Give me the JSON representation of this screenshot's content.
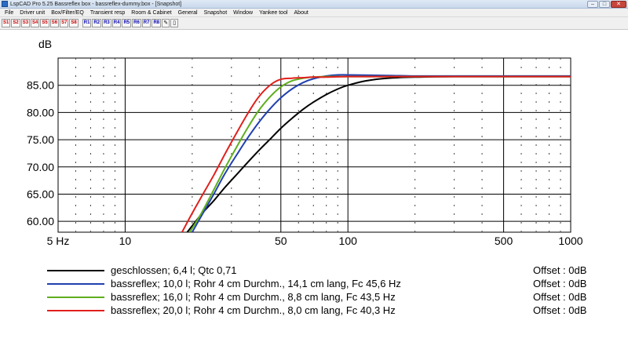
{
  "window": {
    "title": "LspCAD Pro 5.25 Bassreflex box - bassreflex-dummy.box - [Snapshot]",
    "minimize": "–",
    "maximize": "□",
    "close": "✕"
  },
  "menu": [
    "File",
    "Driver unit",
    "Box/Filter/EQ",
    "Transient resp",
    "Room & Cabinet",
    "General",
    "Snapshot",
    "Window",
    "Yankee tool",
    "About"
  ],
  "toolbar": {
    "snapshots": [
      "S1",
      "S2",
      "S3",
      "S4",
      "S5",
      "S6",
      "S7",
      "S8"
    ],
    "references": [
      "R1",
      "R2",
      "R3",
      "R4",
      "R5",
      "R6",
      "R7",
      "R8"
    ],
    "icons": [
      "pen-icon",
      "clipboard-icon"
    ],
    "snapshot_color": "#cc0000",
    "reference_color": "#0000b0"
  },
  "chart_data": {
    "type": "line",
    "ylabel": "dB",
    "xscale": "log",
    "xlim": [
      5,
      1000
    ],
    "ylim": [
      58,
      90
    ],
    "grid": true,
    "x_ticks": [
      5,
      10,
      50,
      100,
      500,
      1000
    ],
    "x_tick_labels": [
      "5 Hz",
      "10",
      "50",
      "100",
      "500",
      "1000"
    ],
    "y_ticks": [
      60,
      65,
      70,
      75,
      80,
      85
    ],
    "y_tick_labels": [
      "60.00",
      "65.00",
      "70.00",
      "75.00",
      "80.00",
      "85.00"
    ],
    "series": [
      {
        "name": "geschlossen; 6,4 l; Qtc 0,71",
        "offset": "Offset : 0dB",
        "color": "#000000",
        "x": [
          19,
          22,
          25,
          28,
          32,
          36,
          40,
          45,
          50,
          56,
          63,
          70,
          80,
          90,
          100,
          120,
          150,
          200,
          300,
          500,
          1000
        ],
        "y": [
          58,
          61.3,
          63.8,
          66.2,
          68.8,
          71.1,
          73.1,
          75.2,
          77.1,
          78.9,
          80.6,
          81.9,
          83.3,
          84.3,
          85.0,
          85.8,
          86.3,
          86.5,
          86.6,
          86.6,
          86.6
        ]
      },
      {
        "name": "bassreflex; 10,0 l; Rohr 4 cm Durchm., 14,1 cm lang,  Fc 45,6 Hz",
        "offset": "Offset : 0dB",
        "color": "#2040b0",
        "x": [
          20,
          22,
          25,
          28,
          32,
          36,
          40,
          45,
          50,
          56,
          63,
          70,
          80,
          90,
          100,
          150,
          200,
          300,
          500,
          1000
        ],
        "y": [
          58,
          61.0,
          65.0,
          68.7,
          72.5,
          75.7,
          78.3,
          80.8,
          82.7,
          84.3,
          85.5,
          86.2,
          86.7,
          86.9,
          86.9,
          86.8,
          86.7,
          86.7,
          86.7,
          86.7
        ]
      },
      {
        "name": "bassreflex; 16,0 l; Rohr 4 cm Durchm., 8,8 cm lang,  Fc 43,5 Hz",
        "offset": "Offset : 0dB",
        "color": "#5fae1e",
        "x": [
          19.5,
          22,
          25,
          28,
          32,
          36,
          40,
          45,
          50,
          56,
          63,
          70,
          80,
          90,
          100,
          150,
          200,
          300,
          500,
          1000
        ],
        "y": [
          58,
          61.5,
          65.8,
          69.7,
          74.0,
          77.6,
          80.5,
          83.0,
          84.7,
          85.8,
          86.3,
          86.5,
          86.6,
          86.6,
          86.6,
          86.6,
          86.6,
          86.6,
          86.6,
          86.6
        ]
      },
      {
        "name": "bassreflex; 20,0 l; Rohr 4 cm Durchm., 8,0 cm lang,  Fc 40,3 Hz",
        "offset": "Offset : 0dB",
        "color": "#e0201c",
        "x": [
          18,
          20,
          22,
          25,
          28,
          32,
          36,
          40,
          45,
          50,
          56,
          63,
          70,
          80,
          100,
          150,
          200,
          300,
          500,
          1000
        ],
        "y": [
          58,
          61.5,
          64.5,
          68.5,
          72.3,
          76.6,
          80.2,
          83.0,
          85.1,
          86.1,
          86.3,
          86.4,
          86.5,
          86.5,
          86.6,
          86.6,
          86.6,
          86.6,
          86.6,
          86.6
        ]
      }
    ]
  }
}
